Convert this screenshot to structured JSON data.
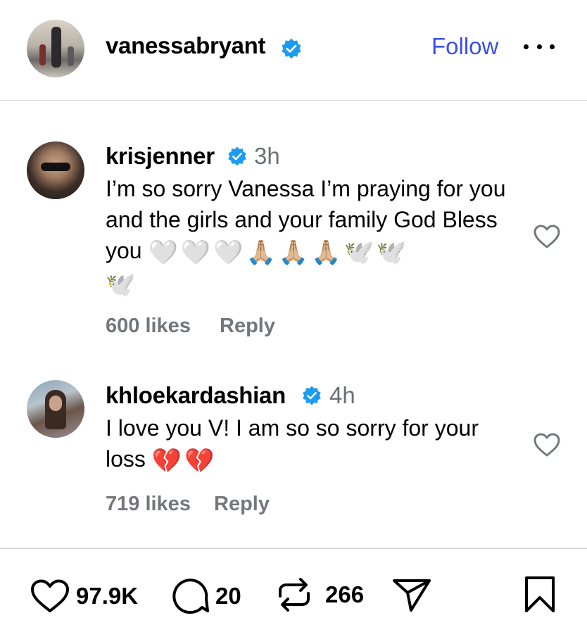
{
  "header": {
    "username": "vanessabryant",
    "follow_label": "Follow"
  },
  "comments": [
    {
      "username": "krisjenner",
      "time": "3h",
      "text": "I’m so sorry Vanessa I’m praying for you and the girls and your family God Bless you",
      "emojis": [
        "🤍",
        "🤍",
        "🤍",
        "🙏🏼",
        "🙏🏼",
        "🙏🏼",
        "🕊️",
        "🕊️",
        "🕊️"
      ],
      "likes": "600 likes",
      "reply_label": "Reply"
    },
    {
      "username": "khloekardashian",
      "time": "4h",
      "text": "I love you V! I am so so sorry for your loss",
      "emojis": [
        "💔",
        "💔"
      ],
      "likes": "719 likes",
      "reply_label": "Reply"
    }
  ],
  "actions": {
    "likes": "97.9K",
    "comments": "20",
    "reposts": "266"
  },
  "icons": [
    "verified-badge-icon",
    "more-icon",
    "heart-icon",
    "comment-icon",
    "repost-icon",
    "share-icon",
    "bookmark-icon"
  ],
  "colors": {
    "accent": "#3a50e8",
    "verified": "#1d9bf0",
    "muted": "#73777d"
  }
}
